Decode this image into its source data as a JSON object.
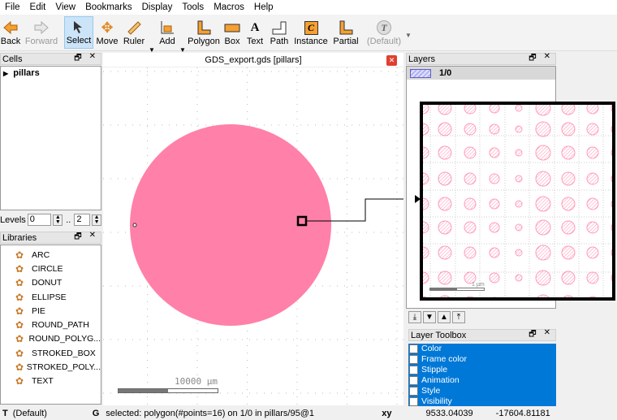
{
  "menu": [
    "File",
    "Edit",
    "View",
    "Bookmarks",
    "Display",
    "Tools",
    "Macros",
    "Help"
  ],
  "toolbar": {
    "back": "Back",
    "forward": "Forward",
    "select": "Select",
    "move": "Move",
    "ruler": "Ruler",
    "add": "Add",
    "polygon": "Polygon",
    "box": "Box",
    "text": "Text",
    "path": "Path",
    "instance": "Instance",
    "partial": "Partial",
    "default": "(Default)"
  },
  "cells": {
    "title": "Cells",
    "tree": [
      "pillars"
    ],
    "levels_label": "Levels",
    "level_from": "0",
    "level_sep": "..",
    "level_to": "2"
  },
  "libraries": {
    "title": "Libraries",
    "items": [
      "ARC",
      "CIRCLE",
      "DONUT",
      "ELLIPSE",
      "PIE",
      "ROUND_PATH",
      "ROUND_POLYG...",
      "STROKED_BOX",
      "STROKED_POLY...",
      "TEXT"
    ]
  },
  "canvas": {
    "title": "GDS_export.gds [pillars]",
    "scale_label": "10000 µm",
    "inset_scale_label": "1 µm",
    "shape_color": "#ff80a8"
  },
  "layers": {
    "title": "Layers",
    "items": [
      {
        "name": "1/0",
        "color": "#9090e0"
      }
    ]
  },
  "layer_toolbox": {
    "title": "Layer Toolbox",
    "items": [
      "Color",
      "Frame color",
      "Stipple",
      "Animation",
      "Style",
      "Visibility"
    ],
    "accent": "#0078d7"
  },
  "status": {
    "t_key": "T",
    "t_val": "(Default)",
    "g_key": "G",
    "message": "selected: polygon(#points=16) on 1/0 in pillars/95@1",
    "xy": "xy",
    "x": "9533.04039",
    "y": "-17604.81181"
  }
}
